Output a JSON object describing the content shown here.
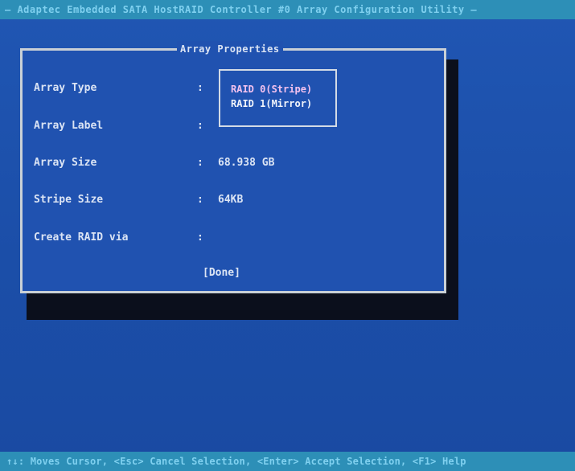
{
  "titlebar": {
    "text_lead": "— Adaptec Embedded SATA HostRAID Controller #0 Array Configuration Utility —"
  },
  "dialog": {
    "title": "Array Properties",
    "fields": [
      {
        "label": "Array Type",
        "colon": ":",
        "value": ""
      },
      {
        "label": "Array Label",
        "colon": ":",
        "value": ""
      },
      {
        "label": "Array Size",
        "colon": ":",
        "value": "68.938 GB"
      },
      {
        "label": "Stripe Size",
        "colon": ":",
        "value": "64KB"
      },
      {
        "label": "Create RAID via",
        "colon": ":",
        "value": ""
      }
    ],
    "done_label": "[Done]"
  },
  "popup": {
    "options": [
      {
        "label": "RAID 0(Stripe)",
        "selected": true
      },
      {
        "label": "RAID 1(Mirror)",
        "selected": false
      }
    ]
  },
  "statusbar": {
    "text": "↑↓: Moves Cursor, <Esc> Cancel Selection, <Enter> Accept Selection, <F1> Help"
  }
}
